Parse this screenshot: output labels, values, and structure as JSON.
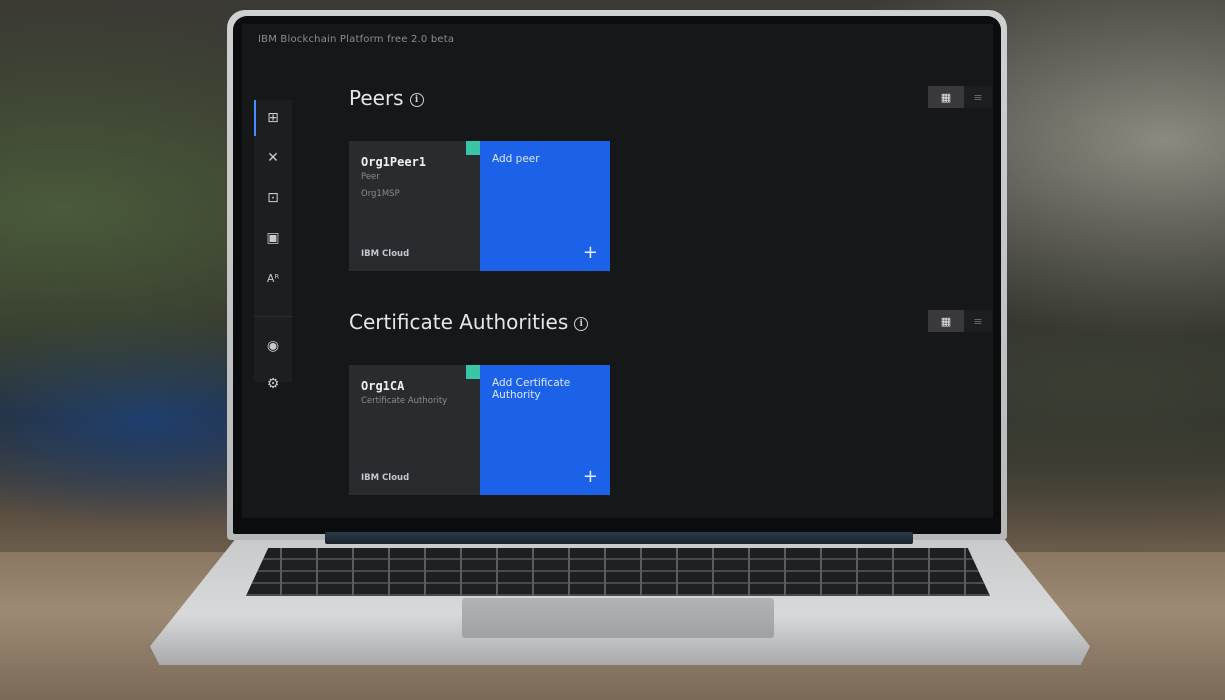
{
  "app": {
    "title": "IBM Blockchain Platform free 2.0 beta"
  },
  "sidenav": {
    "items": [
      {
        "name": "nodes",
        "icon": "grid-icon",
        "glyph": "⊞",
        "active": true
      },
      {
        "name": "channels",
        "icon": "network-icon",
        "glyph": "✕"
      },
      {
        "name": "smart-contracts",
        "icon": "contract-icon",
        "glyph": "⊡"
      },
      {
        "name": "wallet",
        "icon": "wallet-icon",
        "glyph": "▣"
      },
      {
        "name": "users",
        "icon": "users-icon",
        "glyph": "Aᴿ"
      },
      {
        "name": "account",
        "icon": "user-circle-icon",
        "glyph": "◉"
      },
      {
        "name": "settings",
        "icon": "gear-icon",
        "glyph": "⚙"
      }
    ]
  },
  "peers": {
    "title": "Peers",
    "toggle_tile_glyph": "▦",
    "toggle_list_glyph": "≡",
    "card": {
      "name": "Org1Peer1",
      "type": "Peer",
      "msp": "Org1MSP",
      "location": "IBM Cloud",
      "status_color": "#38c6a6"
    },
    "add": {
      "label": "Add peer",
      "plus": "+"
    }
  },
  "cas": {
    "title": "Certificate Authorities",
    "toggle_tile_glyph": "▦",
    "toggle_list_glyph": "≡",
    "card": {
      "name": "Org1CA",
      "type": "Certificate Authority",
      "location": "IBM Cloud",
      "status_color": "#38c6a6"
    },
    "add": {
      "label": "Add Certificate Authority",
      "plus": "+"
    }
  },
  "colors": {
    "accent": "#1b62e8",
    "status_ok": "#38c6a6",
    "screen_bg": "#161719"
  }
}
